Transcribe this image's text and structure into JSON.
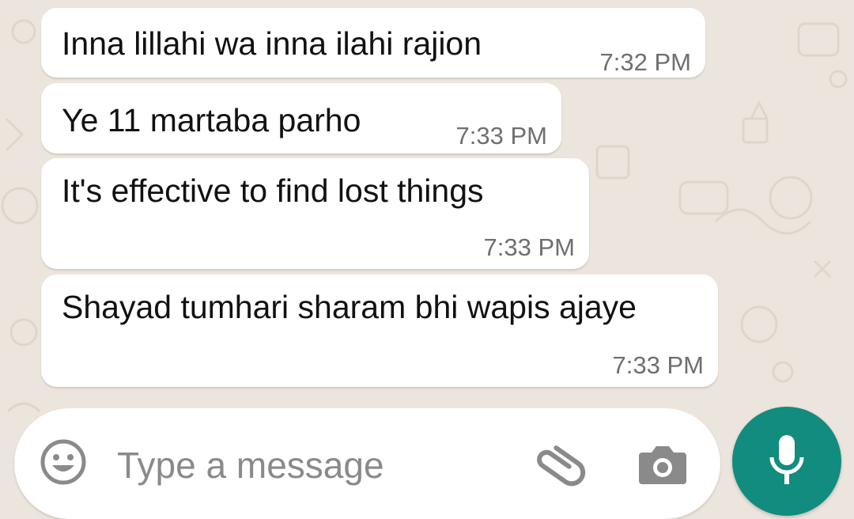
{
  "messages": [
    {
      "text": "Inna lillahi wa inna ilahi rajion",
      "time": "7:32 PM"
    },
    {
      "text": "Ye 11 martaba parho",
      "time": "7:33 PM"
    },
    {
      "text": "It's effective to find lost things",
      "time": "7:33 PM"
    },
    {
      "text": "Shayad tumhari sharam bhi wapis ajaye",
      "time": "7:33 PM"
    }
  ],
  "composer": {
    "placeholder": "Type a message",
    "emoji_icon": "emoji-icon",
    "attach_icon": "paperclip-icon",
    "camera_icon": "camera-icon",
    "mic_icon": "microphone-icon"
  },
  "colors": {
    "wallpaper": "#ece5dd",
    "bubble": "#ffffff",
    "accent": "#128c7e"
  }
}
